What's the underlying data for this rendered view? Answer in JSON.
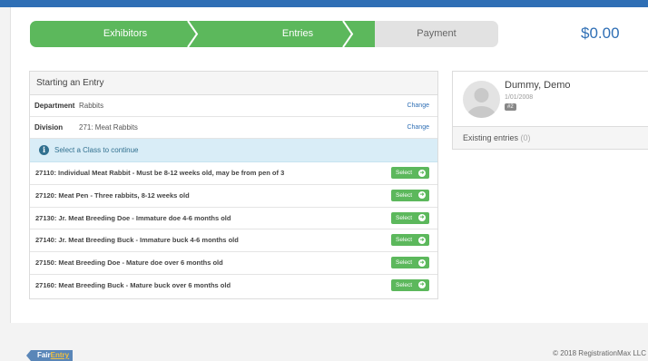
{
  "steps": [
    "Exhibitors",
    "Entries",
    "Payment"
  ],
  "total": "$0.00",
  "entry_panel": {
    "title": "Starting an Entry",
    "department": {
      "label": "Department",
      "value": "Rabbits",
      "action": "Change"
    },
    "division": {
      "label": "Division",
      "value": "271: Meat Rabbits",
      "action": "Change"
    },
    "notice": "Select a Class to continue",
    "select_label": "Select",
    "classes": [
      "27110: Individual Meat Rabbit - Must be 8-12 weeks old, may be from pen of 3",
      "27120: Meat Pen - Three rabbits, 8-12 weeks old",
      "27130: Jr. Meat Breeding Doe - Immature doe 4-6 months old",
      "27140: Jr. Meat Breeding Buck - Immature buck 4-6 months old",
      "27150: Meat Breeding Doe - Mature doe over 6 months old",
      "27160: Meat Breeding Buck - Mature buck over 6 months old"
    ]
  },
  "exhibitor": {
    "name": "Dummy, Demo",
    "dob": "1/01/2008",
    "badge": "#2",
    "existing_label": "Existing entries",
    "existing_count": "(0)"
  },
  "footer": {
    "logo_part1": "Fair",
    "logo_part2": "Entry",
    "copyright": "© 2018 RegistrationMax LLC"
  },
  "colors": {
    "accent": "#2f6fb5",
    "success": "#5cb85c",
    "info_bg": "#d9edf7"
  }
}
